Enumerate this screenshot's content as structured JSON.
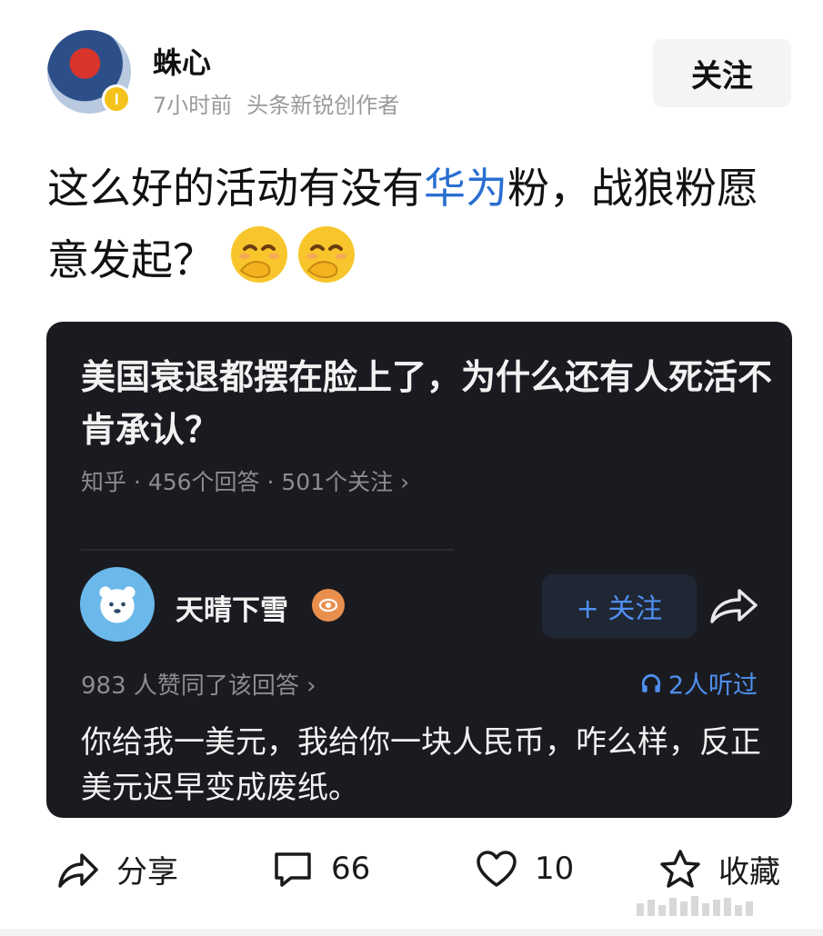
{
  "author": {
    "name": "蛛心",
    "time": "7小时前",
    "title": "头条新锐创作者",
    "follow_label": "关注"
  },
  "post": {
    "text_before": "这么好的活动有没有",
    "text_highlight": "华为",
    "text_after": "粉，战狼粉愿意发起？"
  },
  "card": {
    "question_title": "美国衰退都摆在脸上了，为什么还有人死活不肯承认？",
    "source_meta": "知乎 · 456个回答 · 501个关注 ›",
    "answerer_name": "天晴下雪",
    "follow_label": "+ 关注",
    "agree_text": "983 人赞同了该回答 ›",
    "listened_text": "2人听过",
    "answer_text": "你给我一美元，我给你一块人民币，咋么样，反正美元迟早变成废纸。"
  },
  "actions": {
    "share_label": "分享",
    "comment_count": "66",
    "like_count": "10",
    "favorite_label": "收藏"
  },
  "colors": {
    "highlight": "#2a6fd1",
    "card_bg": "#1a1b20",
    "link_blue": "#4f8ff0"
  }
}
